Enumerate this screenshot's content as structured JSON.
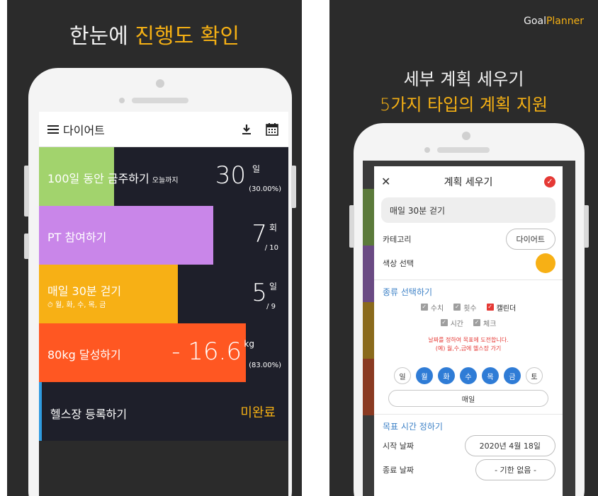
{
  "left": {
    "headline_white": "한눈에 ",
    "headline_accent": "진행도 확인",
    "appbar_title": "다이어트",
    "rows": [
      {
        "title": "100일 동안 금주하기",
        "tiny": "오늘까지",
        "num": "30",
        "unit": "일",
        "small": "(30.00%)",
        "progress": 0.3,
        "color": "#a2d36d"
      },
      {
        "title": "PT 참여하기",
        "num": "7",
        "unit": "회",
        "small": "/ 10",
        "progress": 0.7,
        "color": "#c986e9"
      },
      {
        "title": "매일 30분 걷기",
        "sub": "⏱ 월, 화, 수, 목, 금",
        "num": "5",
        "unit": "일",
        "small": "/ 9",
        "progress": 0.5556,
        "color": "#f7b015"
      },
      {
        "title": "80kg 달성하기",
        "num": "- 16.6",
        "unit": "kg",
        "small": "(83.00%)",
        "progress": 0.83,
        "color": "#ff5722"
      },
      {
        "title": "헬스장 등록하기",
        "status": "미완료",
        "status_color": "#f5b014"
      }
    ]
  },
  "right": {
    "brand_white": "Goal",
    "brand_accent": "Planner",
    "headline_line1": "세부 계획 세우기",
    "headline_line2": "5가지 타입의 계획 지원",
    "dialog_title": "계획 세우기",
    "plan_name": "매일 30분 걷기",
    "category_label": "카테고리",
    "category_value": "다이어트",
    "color_label": "색상 선택",
    "type_section": "종류 선택하기",
    "types_row1": [
      "수치",
      "횟수",
      "캘린더"
    ],
    "types_row2": [
      "시간",
      "체크"
    ],
    "hint_line1": "날짜를 정하여 목표에 도전합니다.",
    "hint_line2": "(예) 월,수,금에 헬스장 가기",
    "days": [
      "일",
      "월",
      "화",
      "수",
      "목",
      "금",
      "토"
    ],
    "every_day": "매일",
    "time_section": "목표 시간 정하기",
    "start_label": "시작 날짜",
    "start_value": "2020년 4월 18일",
    "end_label": "종료 날짜",
    "end_value": "- 기한 없음 -"
  },
  "colors": {
    "accent": "#f5b014",
    "blue": "#2f7cd6",
    "red": "#e53935",
    "orange_dot": "#f7b015"
  }
}
